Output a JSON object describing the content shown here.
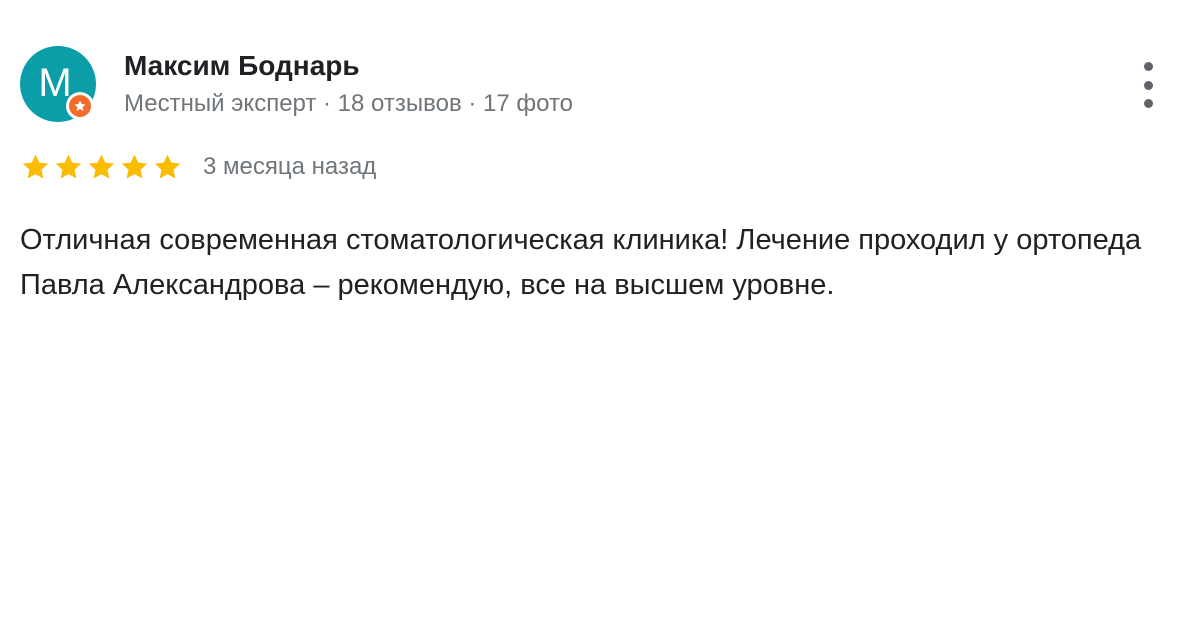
{
  "review": {
    "author": {
      "initial": "M",
      "name": "Максим Боднарь",
      "meta": "Местный эксперт · 18 отзывов · 17 фото",
      "avatar_color": "#0b9ea8",
      "badge_icon": "local-guide-star-icon",
      "badge_color": "#f26b2a"
    },
    "menu_icon": "more-vertical-icon",
    "rating": {
      "stars": 5,
      "max": 5,
      "star_icon": "star-icon",
      "star_color": "#fbbc04"
    },
    "date": "3 месяца назад",
    "text": "Отличная современная стоматологическая клиника! Лечение проходил у ортопеда Павла Александрова – рекомендую, все на высшем уровне."
  }
}
